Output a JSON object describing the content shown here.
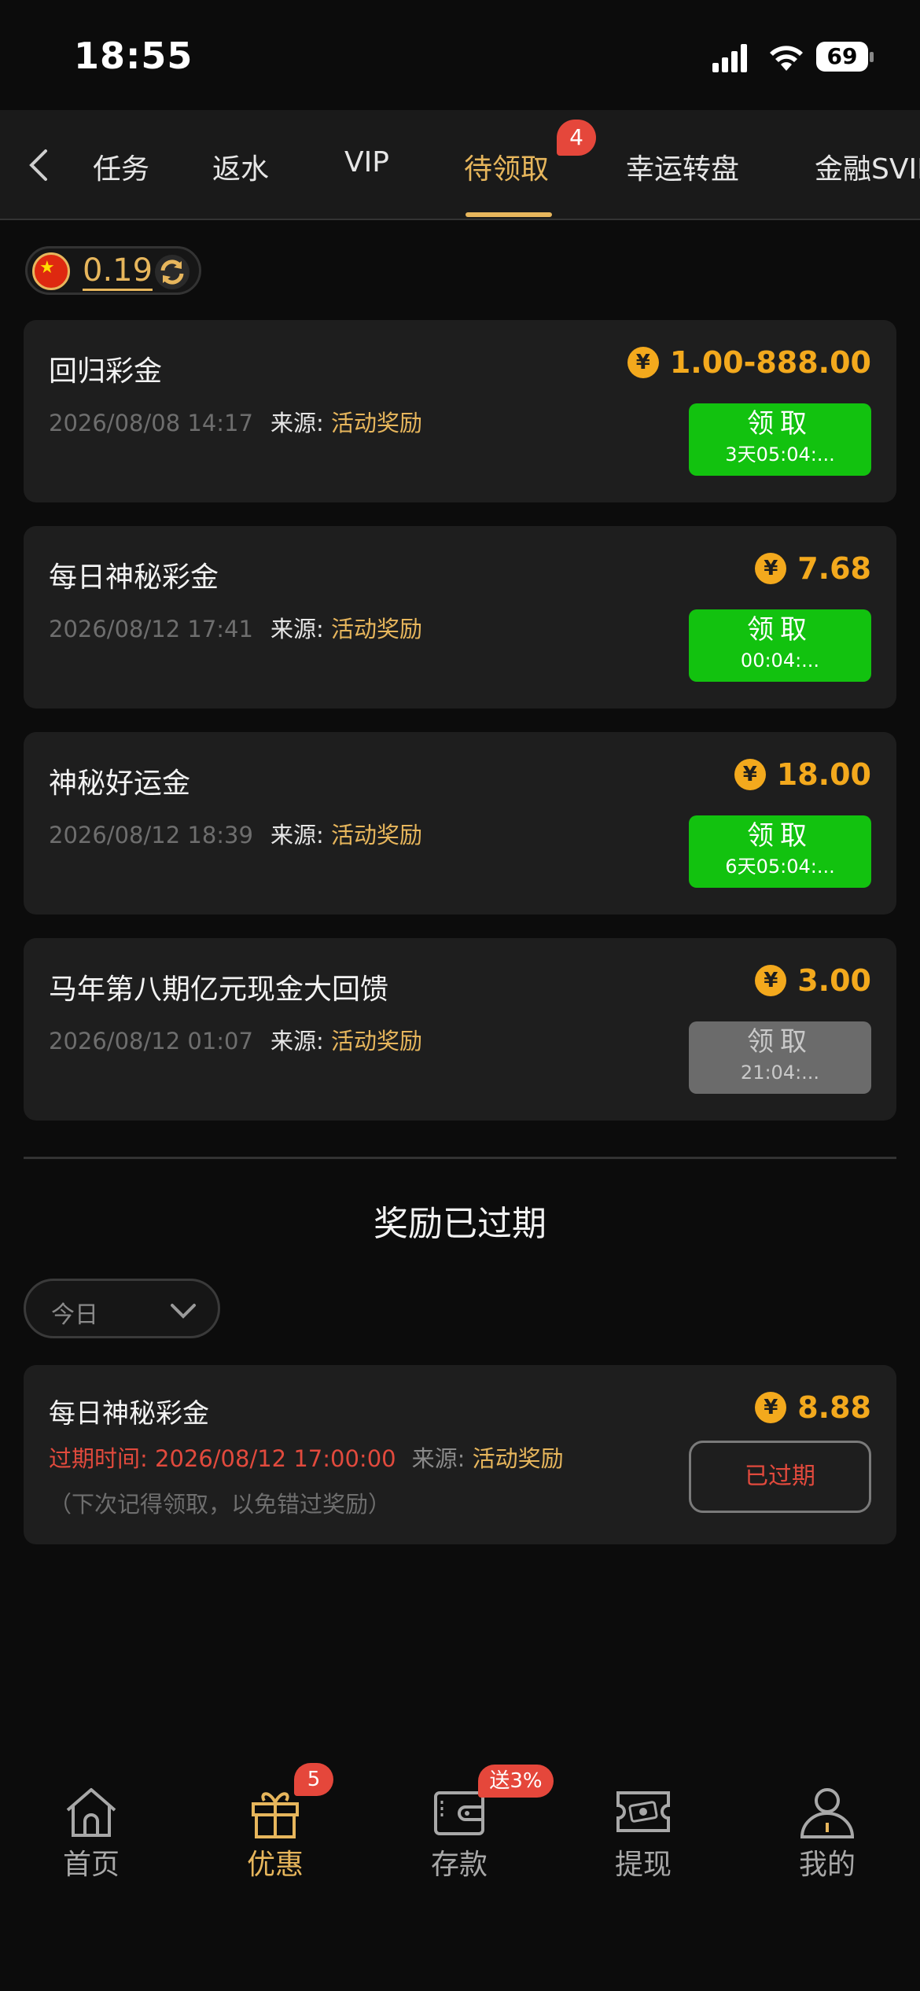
{
  "status_bar": {
    "time": "18:55",
    "battery": "69"
  },
  "tabs": [
    {
      "label": "任务"
    },
    {
      "label": "返水"
    },
    {
      "label": "VIP"
    },
    {
      "label": "待领取",
      "badge": "4",
      "active": true
    },
    {
      "label": "幸运转盘"
    },
    {
      "label": "金融SVIP"
    }
  ],
  "balance": {
    "value": "0.19"
  },
  "rewards": [
    {
      "title": "回归彩金",
      "date": "2026/08/08 14:17",
      "source_label": "来源:",
      "source": "活动奖励",
      "amount": "1.00-888.00",
      "button": "领取",
      "timer": "3天05:04:...",
      "enabled": true
    },
    {
      "title": "每日神秘彩金",
      "date": "2026/08/12 17:41",
      "source_label": "来源:",
      "source": "活动奖励",
      "amount": "7.68",
      "button": "领取",
      "timer": "00:04:...",
      "enabled": true
    },
    {
      "title": "神秘好运金",
      "date": "2026/08/12 18:39",
      "source_label": "来源:",
      "source": "活动奖励",
      "amount": "18.00",
      "button": "领取",
      "timer": "6天05:04:...",
      "enabled": true
    },
    {
      "title": "马年第八期亿元现金大回馈",
      "date": "2026/08/12 01:07",
      "source_label": "来源:",
      "source": "活动奖励",
      "amount": "3.00",
      "button": "领取",
      "timer": "21:04:...",
      "enabled": false
    }
  ],
  "expired_section": {
    "title": "奖励已过期",
    "filter": "今日",
    "item": {
      "title": "每日神秘彩金",
      "expire_text": "过期时间: 2026/08/12 17:00:00",
      "source_label": "来源:",
      "source": "活动奖励",
      "note": "（下次记得领取，以免错过奖励）",
      "amount": "8.88",
      "status": "已过期"
    }
  },
  "coin_symbol": "¥",
  "bottom_nav": [
    {
      "label": "首页",
      "icon": "home-icon"
    },
    {
      "label": "优惠",
      "icon": "gift-icon",
      "badge": "5",
      "active": true
    },
    {
      "label": "存款",
      "icon": "wallet-icon",
      "badge": "送3%"
    },
    {
      "label": "提现",
      "icon": "cash-icon"
    },
    {
      "label": "我的",
      "icon": "profile-icon"
    }
  ],
  "colors": {
    "accent": "#e7b65c",
    "claim_green": "#12c20f",
    "badge_red": "#e5473b",
    "coin": "#f3a91d"
  }
}
